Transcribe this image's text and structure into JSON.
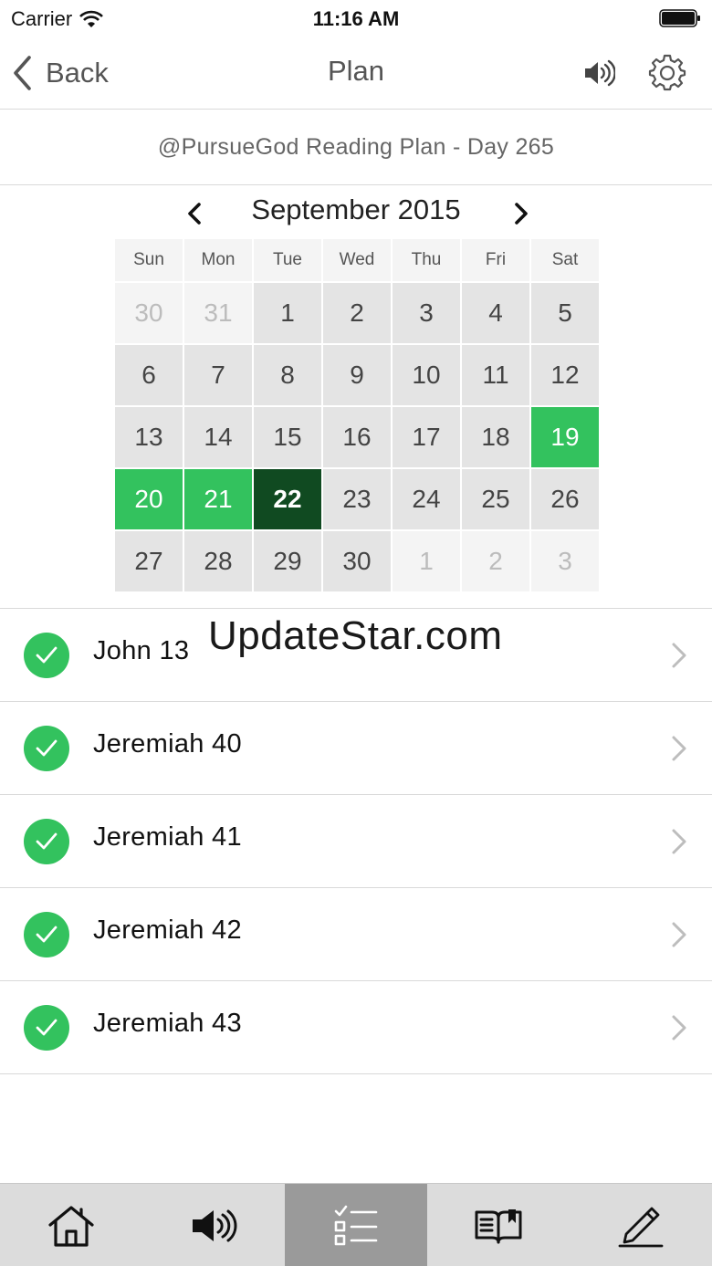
{
  "status_bar": {
    "carrier": "Carrier",
    "time": "11:16 AM"
  },
  "nav": {
    "back_label": "Back",
    "title": "Plan"
  },
  "plan": {
    "title": "@PursueGod Reading Plan - Day 265"
  },
  "calendar": {
    "month_label": "September 2015",
    "weekdays": [
      "Sun",
      "Mon",
      "Tue",
      "Wed",
      "Thu",
      "Fri",
      "Sat"
    ],
    "days": [
      {
        "label": "30",
        "state": "other"
      },
      {
        "label": "31",
        "state": "other"
      },
      {
        "label": "1",
        "state": "normal"
      },
      {
        "label": "2",
        "state": "normal"
      },
      {
        "label": "3",
        "state": "normal"
      },
      {
        "label": "4",
        "state": "normal"
      },
      {
        "label": "5",
        "state": "normal"
      },
      {
        "label": "6",
        "state": "normal"
      },
      {
        "label": "7",
        "state": "normal"
      },
      {
        "label": "8",
        "state": "normal"
      },
      {
        "label": "9",
        "state": "normal"
      },
      {
        "label": "10",
        "state": "normal"
      },
      {
        "label": "11",
        "state": "normal"
      },
      {
        "label": "12",
        "state": "normal"
      },
      {
        "label": "13",
        "state": "normal"
      },
      {
        "label": "14",
        "state": "normal"
      },
      {
        "label": "15",
        "state": "normal"
      },
      {
        "label": "16",
        "state": "normal"
      },
      {
        "label": "17",
        "state": "normal"
      },
      {
        "label": "18",
        "state": "normal"
      },
      {
        "label": "19",
        "state": "done"
      },
      {
        "label": "20",
        "state": "done"
      },
      {
        "label": "21",
        "state": "done"
      },
      {
        "label": "22",
        "state": "today"
      },
      {
        "label": "23",
        "state": "normal"
      },
      {
        "label": "24",
        "state": "normal"
      },
      {
        "label": "25",
        "state": "normal"
      },
      {
        "label": "26",
        "state": "normal"
      },
      {
        "label": "27",
        "state": "normal"
      },
      {
        "label": "28",
        "state": "normal"
      },
      {
        "label": "29",
        "state": "normal"
      },
      {
        "label": "30",
        "state": "normal"
      },
      {
        "label": "1",
        "state": "other"
      },
      {
        "label": "2",
        "state": "other"
      },
      {
        "label": "3",
        "state": "other"
      }
    ]
  },
  "readings": [
    {
      "label": "John 13",
      "completed": true
    },
    {
      "label": "Jeremiah 40",
      "completed": true
    },
    {
      "label": "Jeremiah 41",
      "completed": true
    },
    {
      "label": "Jeremiah 42",
      "completed": true
    },
    {
      "label": "Jeremiah 43",
      "completed": true
    }
  ],
  "watermark": "UpdateStar.com",
  "tab_bar": {
    "tabs": [
      {
        "icon": "home-icon",
        "active": false
      },
      {
        "icon": "speaker-icon",
        "active": false
      },
      {
        "icon": "checklist-icon",
        "active": true
      },
      {
        "icon": "book-icon",
        "active": false
      },
      {
        "icon": "pencil-icon",
        "active": false
      }
    ]
  },
  "colors": {
    "completed_green": "#33c25e",
    "today_green": "#104a21",
    "day_cell": "#e4e4e4",
    "active_tab": "#9a9a9a"
  }
}
